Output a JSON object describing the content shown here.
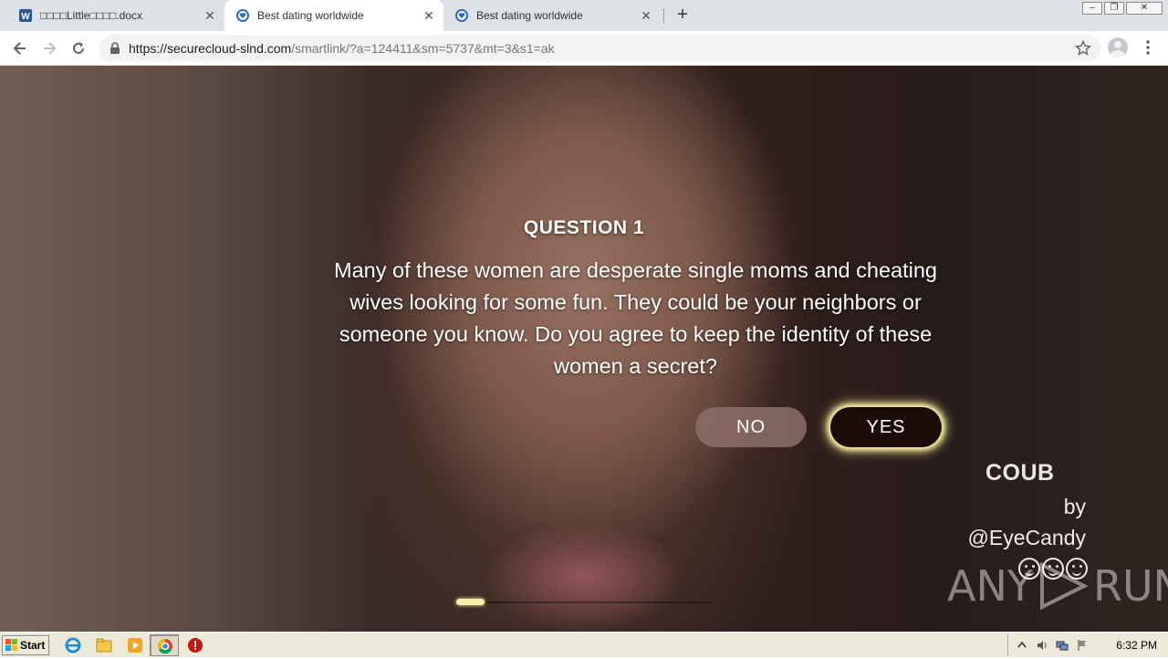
{
  "browser": {
    "tabs": [
      {
        "title": "□□□□Little□□□□.docx",
        "icon": "word-icon",
        "active": false
      },
      {
        "title": "Best dating worldwide",
        "icon": "heart-shield-icon",
        "active": true
      },
      {
        "title": "Best dating worldwide",
        "icon": "heart-shield-icon",
        "active": false
      }
    ],
    "new_tab": "+",
    "url_host": "https://securecloud-slnd.com",
    "url_path": "/smartlink/?a=124411&sm=5737&mt=3&s1=ak",
    "window_buttons": {
      "minimize": "–",
      "restore": "❐",
      "close": "✕"
    }
  },
  "page": {
    "question_label": "QUESTION 1",
    "question_text": "Many of these women are desperate single moms and cheating wives looking for some fun. They could be your neighbors or someone you know. Do you agree to keep the identity of these women a secret?",
    "no_label": "NO",
    "yes_label": "YES",
    "progress_fraction": 0.11,
    "coub_brand": "COUB",
    "by_text": "by",
    "author_handle": "@EyeCandy",
    "watermark_left": "ANY",
    "watermark_right": "RUN"
  },
  "taskbar": {
    "start_label": "Start",
    "pinned_icons": [
      "ie-icon",
      "explorer-icon",
      "media-player-icon",
      "chrome-icon",
      "stop-icon"
    ],
    "clock": "6:32 PM"
  },
  "colors": {
    "yes_glow": "#fff7b0",
    "yes_bg": "#1a0a08",
    "no_bg": "#8c6e68",
    "tabstrip_bg": "#dee1e6",
    "taskbar_bg": "#ece9d8"
  }
}
